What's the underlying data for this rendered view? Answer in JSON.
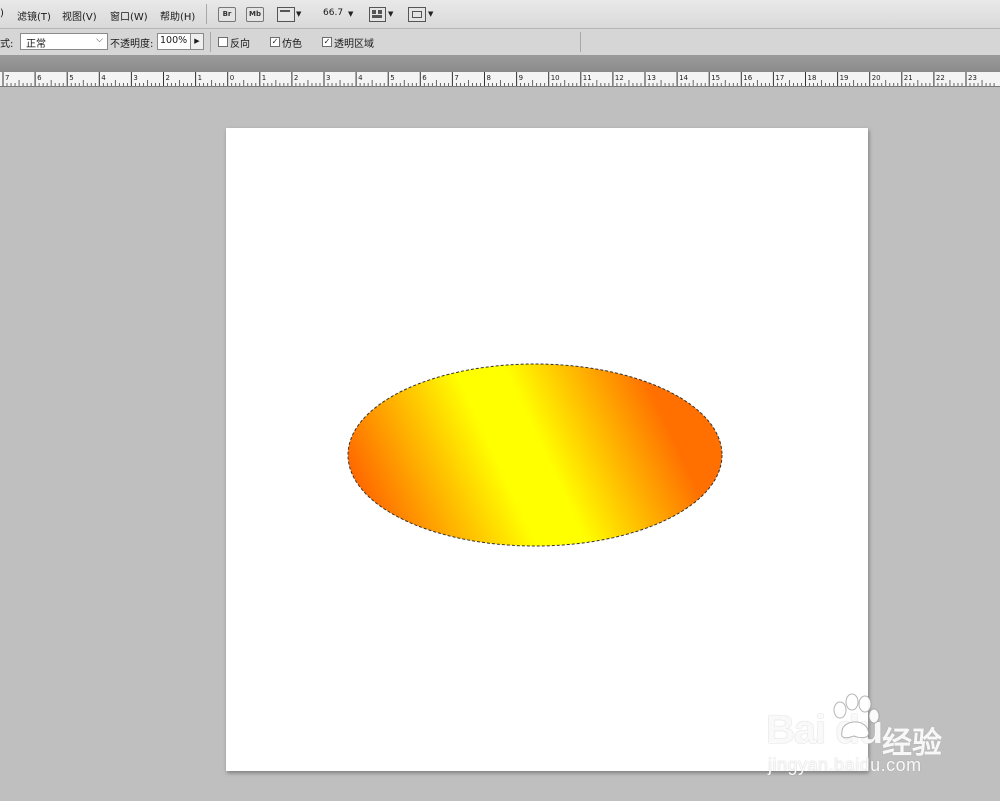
{
  "menubar": {
    "items": [
      {
        "label": ")"
      },
      {
        "label": "滤镜(T)"
      },
      {
        "label": "视图(V)"
      },
      {
        "label": "窗口(W)"
      },
      {
        "label": "帮助(H)"
      }
    ],
    "bridge_label": "Br",
    "minibridge_label": "Mb",
    "zoom_value": "66.7"
  },
  "options": {
    "mode_label": "式:",
    "mode_value": "正常",
    "opacity_label": "不透明度:",
    "opacity_value": "100%",
    "reverse_label": "反向",
    "reverse_checked": false,
    "dither_label": "仿色",
    "dither_checked": true,
    "transparency_label": "透明区域",
    "transparency_checked": true
  },
  "ruler": {
    "labels": [
      "7",
      "6",
      "5",
      "4",
      "3",
      "2",
      "1",
      "0",
      "1",
      "2",
      "3",
      "4",
      "5",
      "6",
      "7",
      "8",
      "9",
      "10",
      "11",
      "12",
      "13",
      "14",
      "15",
      "16",
      "17",
      "18",
      "19",
      "20",
      "21",
      "22",
      "23"
    ]
  },
  "canvas": {
    "background": "#ffffff",
    "gradient_colors": [
      "#ff6600",
      "#ffff00",
      "#ffff00",
      "#ff7000"
    ]
  },
  "watermark": {
    "logo": "Bai  du",
    "cn": "经验",
    "url": "jingyan.baidu.com"
  }
}
